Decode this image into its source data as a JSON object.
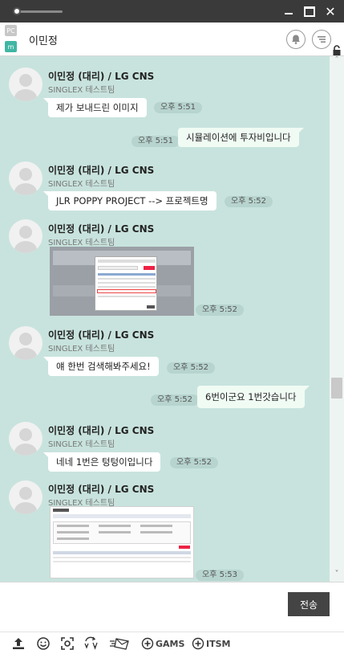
{
  "window": {
    "title_badges": {
      "pc": "PC",
      "mobile": "m"
    },
    "close_glyph": "✕"
  },
  "header": {
    "title": "이민정"
  },
  "chat": {
    "messages": [
      {
        "type": "in",
        "sender": "이민정 (대리) / LG CNS",
        "team": "SINGLEX 테스트팀",
        "text": "제가 보내드린 이미지",
        "time": "오후 5:51"
      },
      {
        "type": "out",
        "text": "시뮬레이션에 투자비입니다",
        "time": "오후 5:51"
      },
      {
        "type": "in",
        "sender": "이민정 (대리) / LG CNS",
        "team": "SINGLEX 테스트팀",
        "text": "JLR POPPY PROJECT  --> 프로젝트명",
        "time": "오후 5:52"
      },
      {
        "type": "in-image",
        "sender": "이민정 (대리) / LG CNS",
        "team": "SINGLEX 테스트팀",
        "time": "오후 5:52"
      },
      {
        "type": "in",
        "sender": "이민정 (대리) / LG CNS",
        "team": "SINGLEX 테스트팀",
        "text": "얘 한번 검색해봐주세요!",
        "time": "오후 5:52"
      },
      {
        "type": "out",
        "text": "6번이군요 1번갓습니다",
        "time": "오후 5:52"
      },
      {
        "type": "in",
        "sender": "이민정 (대리) / LG CNS",
        "team": "SINGLEX 테스트팀",
        "text": "네네 1번은 텅텅이입니다",
        "time": "오후 5:52"
      },
      {
        "type": "in-image",
        "sender": "이민정 (대리) / LG CNS",
        "team": "SINGLEX 테스트팀",
        "time": "오후 5:53"
      }
    ]
  },
  "input": {
    "send_label": "전송"
  },
  "toolbar": {
    "gams_label": "GAMS",
    "itsm_label": "ITSM"
  },
  "colors": {
    "chat_bg": "#c8e3dd",
    "titlebar": "#3a3a3a",
    "send_button": "#444444",
    "mobile_badge": "#3fb6a4"
  }
}
